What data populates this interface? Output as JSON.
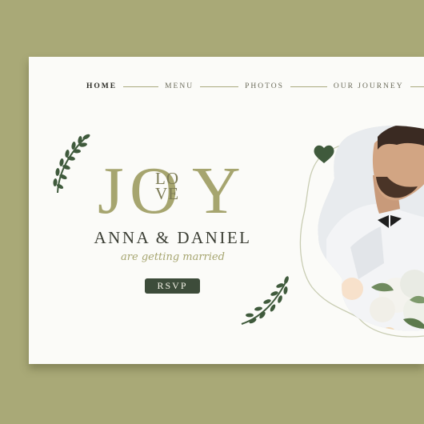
{
  "nav": {
    "items": [
      {
        "label": "HOME",
        "active": true
      },
      {
        "label": "MENU",
        "active": false
      },
      {
        "label": "PHOTOS",
        "active": false
      },
      {
        "label": "OUR JOURNEY",
        "active": false
      }
    ]
  },
  "hero": {
    "joy_j": "J",
    "joy_o": "O",
    "joy_y": "Y",
    "love_top": "LO",
    "love_bottom": "VE",
    "couple": "ANNA & DANIEL",
    "subtitle": "are getting married",
    "rsvp_label": "RSVP"
  },
  "colors": {
    "background": "#a9a977",
    "card": "#fbfbf8",
    "olive_accent": "#a6a56f",
    "dark_green": "#3d4c3a",
    "leaf_green": "#3f5a3c"
  },
  "icons": [
    "leaf-sprig-icon",
    "heart-icon"
  ]
}
